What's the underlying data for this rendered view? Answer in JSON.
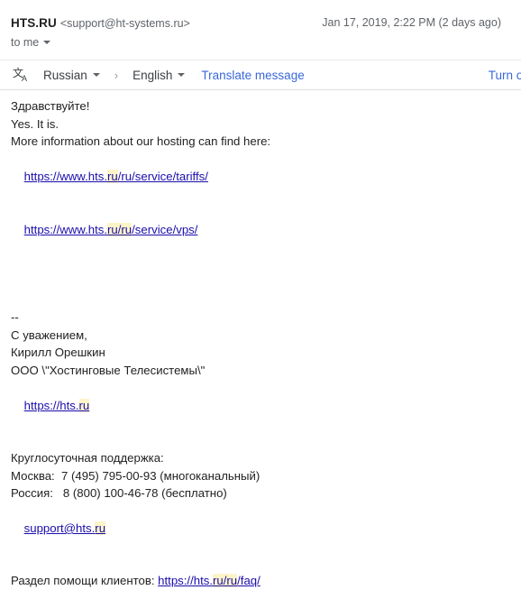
{
  "header": {
    "sender_name": "HTS.RU",
    "sender_email": "<support@ht-systems.ru>",
    "date": "Jan 17, 2019, 2:22 PM (2 days ago)",
    "recipient": "to me"
  },
  "translate_bar": {
    "icon": "translate-icon",
    "source_language": "Russian",
    "target_language": "English",
    "arrow": "›",
    "translate_label": "Translate message",
    "turn_off_label": "Turn of"
  },
  "body": {
    "greeting": "Здравствуйте!",
    "line_yes": "Yes. It is.",
    "line_more_info": "More information about our hosting can find here:",
    "link_tariffs": {
      "pre": "https://www.hts.",
      "hl": "ru",
      "post": "/ru/service/tariffs/"
    },
    "link_vps": {
      "pre": "https://www.hts.",
      "hl": "ru/ru",
      "post": "/service/vps/"
    },
    "sig_dashes": "--",
    "sig_regards": "С уважением,",
    "sig_name": "Кирилл Орешкин",
    "sig_company": "ООО \\\"Хостинговые Телесистемы\\\"",
    "link_site": {
      "pre": "https://hts.",
      "hl": "ru",
      "post": ""
    },
    "support_title": "Круглосуточная поддержка:",
    "phone_moscow": "Москва:  7 (495) 795-00-93 (многоканальный)",
    "phone_russia": "Россия:   8 (800) 100-46-78 (бесплатно)",
    "link_support_email": {
      "pre": "support@hts.",
      "hl": "ru",
      "post": ""
    },
    "help_label": "Раздел помощи клиентов: ",
    "link_faq": {
      "pre": "https://hts.",
      "hl": "ru/ru",
      "post": "/faq/"
    }
  },
  "colors": {
    "link": "#1a0dab",
    "action_link": "#3b68d8",
    "highlight": "#fdf5c8",
    "muted_text": "#5f6368"
  }
}
